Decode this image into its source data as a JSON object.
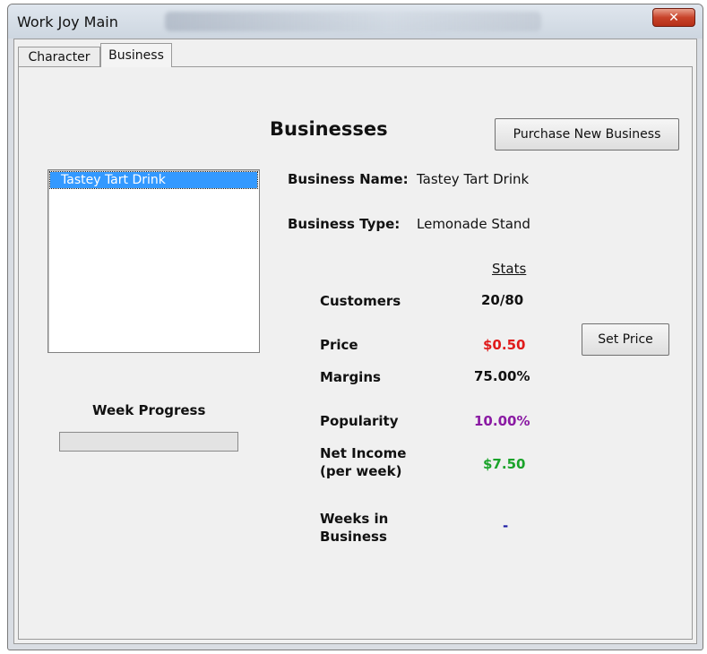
{
  "window": {
    "title": "Work Joy Main"
  },
  "tabs": [
    {
      "label": "Character"
    },
    {
      "label": "Business"
    }
  ],
  "page": {
    "heading": "Businesses",
    "purchase_button": "Purchase New Business"
  },
  "business_list": {
    "items": [
      "Tastey Tart Drink"
    ],
    "selected": "Tastey Tart Drink"
  },
  "details": {
    "name_label": "Business Name:",
    "name_value": "Tastey Tart Drink",
    "type_label": "Business Type:",
    "type_value": "Lemonade Stand"
  },
  "stats": {
    "header": "Stats",
    "customers_label": "Customers",
    "customers_value": "20/80",
    "price_label": "Price",
    "price_value": "$0.50",
    "margins_label": "Margins",
    "margins_value": "75.00%",
    "popularity_label": "Popularity",
    "popularity_value": "10.00%",
    "net_income_label_1": "Net Income",
    "net_income_label_2": "(per week)",
    "net_income_value": "$7.50",
    "weeks_label_1": "Weeks in",
    "weeks_label_2": "Business",
    "weeks_value": "-",
    "set_price_button": "Set Price"
  },
  "week_progress": {
    "label": "Week Progress",
    "fraction": 0
  },
  "colors": {
    "price": "#e01b1b",
    "popularity": "#8a1aa3",
    "net_income": "#1aa32a",
    "weeks": "#1a1aa3",
    "selection": "#3399ff"
  },
  "icons": {
    "close": "close-icon"
  }
}
